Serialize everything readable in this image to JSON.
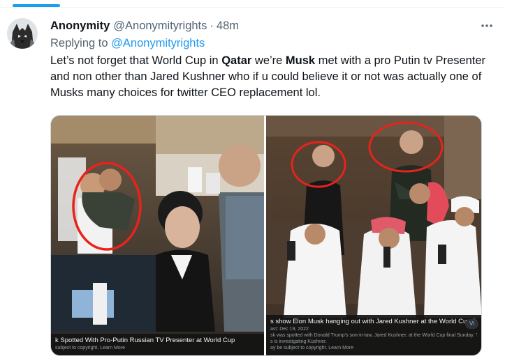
{
  "tweet": {
    "display_name": "Anonymity",
    "handle": "@Anonymityrights",
    "separator": "·",
    "timestamp": "48m",
    "replying_prefix": "Replying to",
    "replying_to": "@Anonymityrights",
    "text": {
      "part1": "Let’s not forget that World Cup in ",
      "bold1": "Qatar",
      "part2": " we’re ",
      "bold2": "Musk",
      "part3": " met with a pro Putin tv Presenter and non other than Jared Kushner who if u could believe it or not was actually one of Musks many choices for twitter CEO replacement lol."
    },
    "more_icon": "more-horizontal-icon"
  },
  "media": {
    "left": {
      "caption_title": "k Spotted With Pro-Putin Russian TV Presenter at World Cup",
      "caption_meta": "subject to copyright. Learn More"
    },
    "right": {
      "caption_title": "s show Elon Musk hanging out with Jared Kushner at the World Cup final",
      "caption_date": "ast: Dec 19, 2022",
      "caption_desc": "sk was spotted with Donald Trump’s son-in-law, Jared Kushner, at the World Cup final Sunday. This comes a",
      "caption_desc2": "s is investigating Kushner.",
      "caption_meta": "ay be subject to copyright. Learn More",
      "pill": "Vi"
    }
  },
  "colors": {
    "accent": "#1d9bf0",
    "text": "#0f1419",
    "secondary": "#536471",
    "circle": "#e8231c"
  }
}
